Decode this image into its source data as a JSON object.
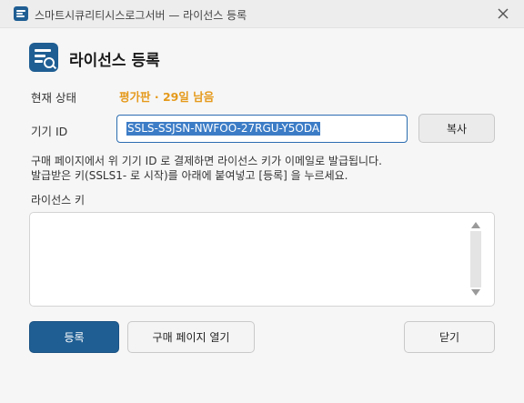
{
  "window": {
    "title": "스마트시큐리티시스로그서버 — 라이선스 등록",
    "close_icon": "close-icon"
  },
  "header": {
    "title": "라이선스 등록",
    "icon": "license-search-icon"
  },
  "status": {
    "label": "현재 상태",
    "value": "평가판 · 29일 남음",
    "value_color": "#e59a1c"
  },
  "device": {
    "label": "기기 ID",
    "value": "SSLS-SSJSN-NWFOO-27RGU-Y5ODA",
    "copy_label": "복사"
  },
  "hint": {
    "line1": "구매 페이지에서 위 기기 ID 로 결제하면 라이선스 키가 이메일로 발급됩니다.",
    "line2": "발급받은 키(SSLS1- 로 시작)를 아래에 붙여넣고 [등록] 을 누르세요."
  },
  "key": {
    "label": "라이선스 키",
    "value": ""
  },
  "buttons": {
    "register": "등록",
    "purchase": "구매 페이지 열기",
    "close": "닫기"
  },
  "colors": {
    "accent": "#1f5e93",
    "selection": "#3c7cc6",
    "focus_border": "#2b6cb0"
  }
}
